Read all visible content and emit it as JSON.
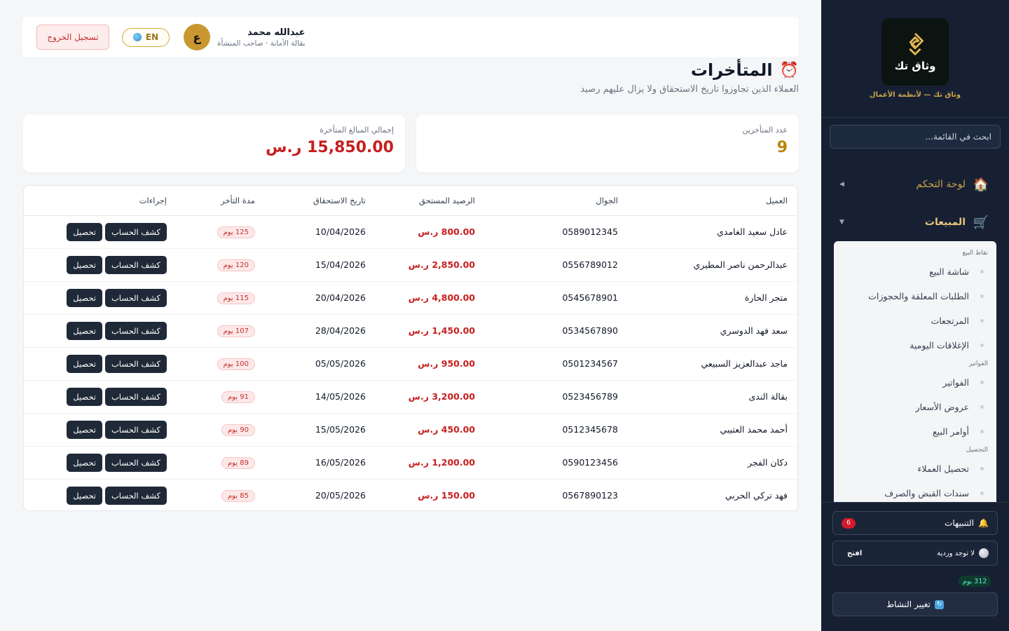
{
  "sidebar": {
    "logo_name": "وثاق تك",
    "logo_tagline": "وثاق تك — لأنظمة الأعمال",
    "search_placeholder": "ابحث في القائمة...",
    "nav": [
      {
        "label": "لوحة التحكم",
        "icon": "house-icon"
      },
      {
        "label": "المبيعات",
        "icon": "cart-icon"
      }
    ],
    "submenu": {
      "groups": [
        {
          "title": "نقاط البيع",
          "items": [
            "شاشة البيع",
            "الطلبات المعلقة والحجوزات",
            "المرتجعات",
            "الإغلاقات اليومية"
          ]
        },
        {
          "title": "الفواتير",
          "items": [
            "الفواتير",
            "عروض الأسعار",
            "أوامر البيع"
          ]
        },
        {
          "title": "التحصيل",
          "items": [
            "تحصيل العملاء",
            "سندات القبض والصرف"
          ]
        }
      ]
    },
    "notifications": {
      "label": "التنبيهات",
      "count": "6"
    },
    "shift": {
      "label": "لا توجد وردية",
      "action": "افتح"
    },
    "days_badge": "312 يوم",
    "change_activity": "تغيير النشاط"
  },
  "header": {
    "logout": "تسجيل الخروج",
    "user_name": "عبدالله محمد",
    "user_role": "بقالة الأمانة · صاحب المنشأة",
    "avatar_letter": "ع",
    "lang": "EN"
  },
  "page": {
    "title": "المتأخرات",
    "subtitle": "العملاء الذين تجاوزوا تاريخ الاستحقاق ولا يزال عليهم رصيد"
  },
  "stats": {
    "count_label": "عدد المتأخرين",
    "count_value": "9",
    "total_label": "إجمالي المبالغ المتأخرة",
    "total_value": "15,850.00 ر.س"
  },
  "table": {
    "headers": [
      "العميل",
      "الجوال",
      "الرصيد المستحق",
      "تاريخ الاستحقاق",
      "مدة التأخر",
      "إجراءات"
    ],
    "action_statement": "كشف الحساب",
    "action_collect": "تحصيل",
    "rows": [
      {
        "client": "عادل سعيد الغامدي",
        "phone": "0589012345",
        "balance": "800.00 ر.س",
        "due": "10/04/2026",
        "delay": "125 يوم"
      },
      {
        "client": "عبدالرحمن ناصر المطيري",
        "phone": "0556789012",
        "balance": "2,850.00 ر.س",
        "due": "15/04/2026",
        "delay": "120 يوم"
      },
      {
        "client": "متجر الحارة",
        "phone": "0545678901",
        "balance": "4,800.00 ر.س",
        "due": "20/04/2026",
        "delay": "115 يوم"
      },
      {
        "client": "سعد فهد الدوسري",
        "phone": "0534567890",
        "balance": "1,450.00 ر.س",
        "due": "28/04/2026",
        "delay": "107 يوم"
      },
      {
        "client": "ماجد عبدالعزيز السبيعي",
        "phone": "0501234567",
        "balance": "950.00 ر.س",
        "due": "05/05/2026",
        "delay": "100 يوم"
      },
      {
        "client": "بقالة الندى",
        "phone": "0523456789",
        "balance": "3,200.00 ر.س",
        "due": "14/05/2026",
        "delay": "91 يوم"
      },
      {
        "client": "أحمد محمد العتيبي",
        "phone": "0512345678",
        "balance": "450.00 ر.س",
        "due": "15/05/2026",
        "delay": "90 يوم"
      },
      {
        "client": "دكان الفجر",
        "phone": "0590123456",
        "balance": "1,200.00 ر.س",
        "due": "16/05/2026",
        "delay": "89 يوم"
      },
      {
        "client": "فهد تركي الحربي",
        "phone": "0567890123",
        "balance": "150.00 ر.س",
        "due": "20/05/2026",
        "delay": "85 يوم"
      }
    ]
  }
}
